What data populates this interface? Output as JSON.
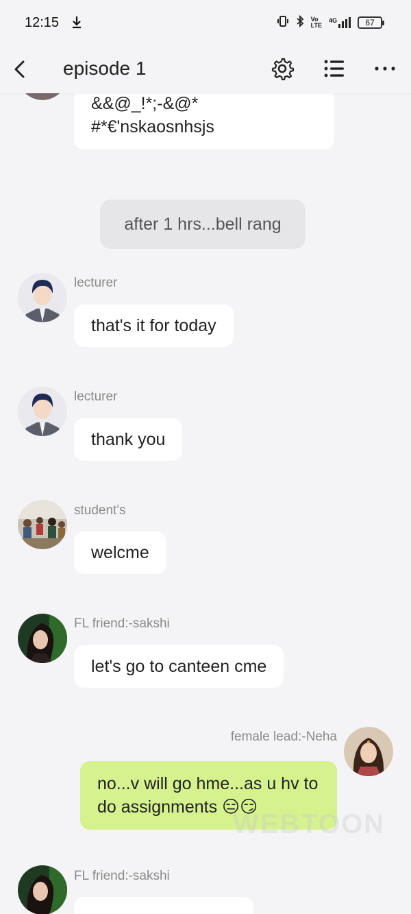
{
  "status_bar": {
    "time": "12:15",
    "download_icon": "download-icon",
    "network_label_vo": "Vo",
    "network_label_lte": "LTE",
    "network_type": "4G",
    "battery": "67"
  },
  "header": {
    "title": "episode 1",
    "back_icon": "chevron-left-icon",
    "settings_icon": "gear-icon",
    "list_icon": "list-icon",
    "more_icon": "more-horizontal-icon"
  },
  "chat": {
    "top_bubble_text": "&&@_!*;-&@*\n#*€'nskaosnhsjs",
    "system_note": "after 1 hrs...bell rang",
    "messages": [
      {
        "sender": "lecturer",
        "text": "that's it for today"
      },
      {
        "sender": "lecturer",
        "text": "thank you"
      },
      {
        "sender": "student's",
        "text": "welcme"
      },
      {
        "sender": "FL friend:-sakshi",
        "text": "let's go to canteen cme"
      },
      {
        "sender": "female lead:-Neha",
        "text": "no...v will go hme...as u hv to do assignments 😑😏"
      },
      {
        "sender": "FL friend:-sakshi",
        "text": ""
      }
    ],
    "watermark": "WEBTOON"
  },
  "colors": {
    "background": "#f4f4f6",
    "bubble_other": "#ffffff",
    "bubble_mine": "#d6f28e",
    "system_note_bg": "#e6e6e9",
    "sender_text": "#8a8a8a"
  }
}
